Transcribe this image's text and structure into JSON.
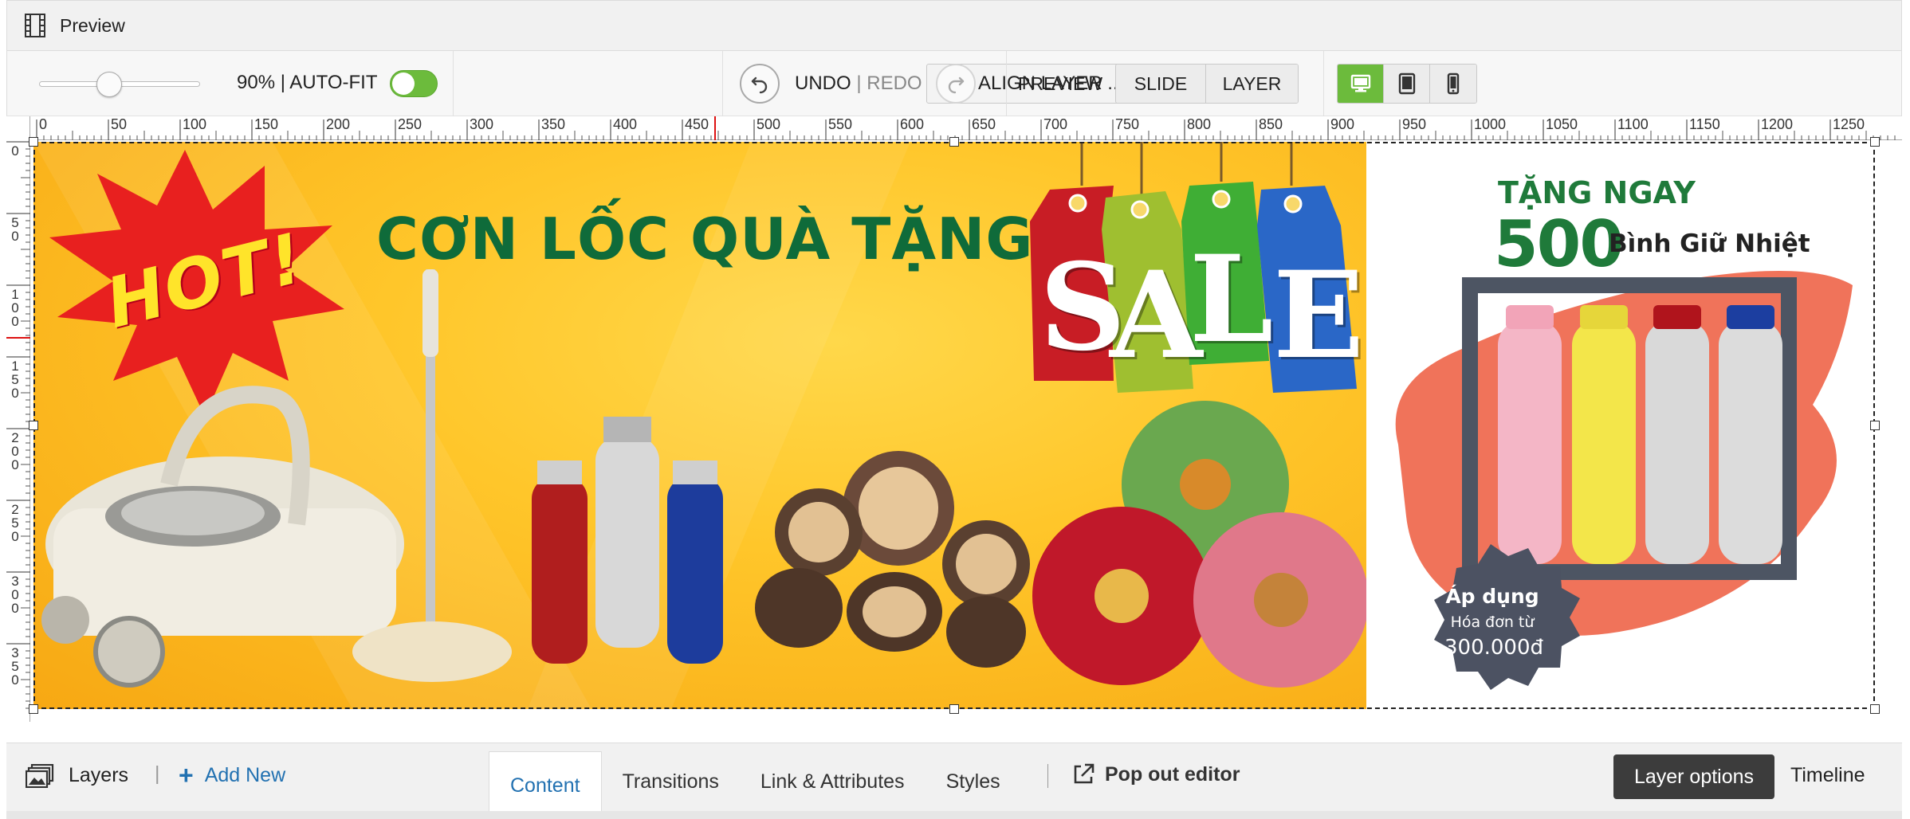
{
  "window": {
    "title": "Preview"
  },
  "toolbar": {
    "zoom_label": "90% | AUTO-FIT",
    "zoom_percent": 90,
    "slider_value_fraction": 0.54,
    "autofit_on": true,
    "align_label": "ALIGN LAYER ...",
    "undo_label": "UNDO",
    "undo_redo_sep": "|",
    "redo_label": "REDO",
    "preview_label": "PREVIEW",
    "slide_label": "SLIDE",
    "layer_label": "LAYER",
    "devices": [
      "desktop-icon",
      "tablet-icon",
      "mobile-icon"
    ],
    "active_device": "desktop",
    "accent_color": "#6cbb3c"
  },
  "ruler": {
    "h_ticks": [
      "0",
      "50",
      "100",
      "150",
      "200",
      "250",
      "300",
      "350",
      "400",
      "450",
      "500",
      "550",
      "600",
      "650",
      "700",
      "750",
      "800",
      "850",
      "900",
      "950",
      "1000",
      "1050",
      "1100",
      "1150",
      "1200",
      "1250"
    ],
    "v_ticks": [
      "0",
      "50",
      "100",
      "150",
      "200",
      "250",
      "300",
      "350"
    ]
  },
  "slide": {
    "hot_text": "HOT!",
    "headline": "CƠN LỐC QUÀ TẶNG",
    "sale_letters": [
      "S",
      "A",
      "L",
      "E"
    ],
    "promo_top": "TẶNG NGAY",
    "promo_number": "500",
    "promo_item": "Bình Giữ Nhiệt",
    "badge_line1": "Áp dụng",
    "badge_line2": "Hóa đơn từ",
    "badge_line3": "300.000đ"
  },
  "bottom": {
    "layers_label": "Layers",
    "separator": "|",
    "add_new_label": "Add New",
    "tabs": [
      "Content",
      "Transitions",
      "Link & Attributes",
      "Styles"
    ],
    "active_tab": "Content",
    "popout_label": "Pop out editor",
    "layer_options_label": "Layer options",
    "timeline_label": "Timeline",
    "link_color": "#2271b1"
  }
}
